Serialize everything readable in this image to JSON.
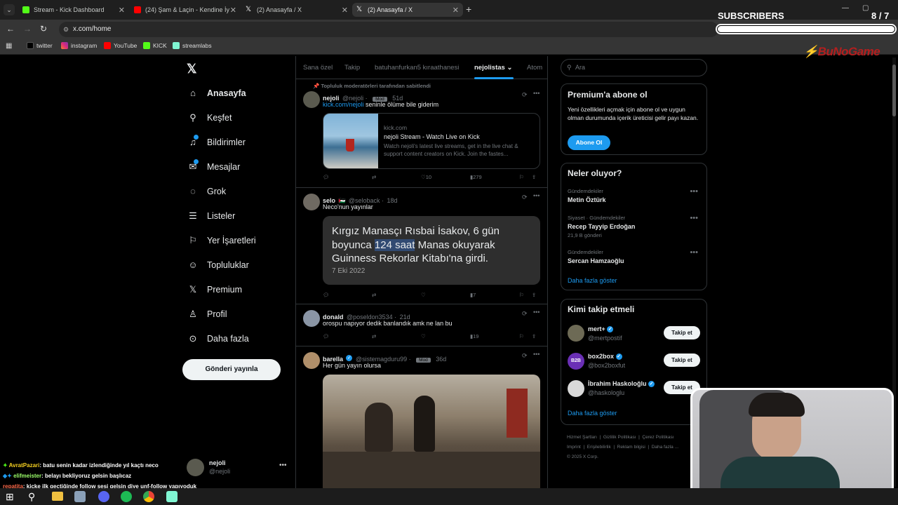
{
  "browser": {
    "tabs": [
      {
        "title": "Stream - Kick Dashboard"
      },
      {
        "title": "(24) Şam & Laçin - Kendine İyi..."
      },
      {
        "title": "(2) Anasayfa / X"
      },
      {
        "title": "(2) Anasayfa / X"
      }
    ],
    "new_tab": "+",
    "url": "x.com/home",
    "bookmarks": [
      "twitter",
      "instagram",
      "YouTube",
      "KICK",
      "streamlabs"
    ]
  },
  "overlay": {
    "subscribers_label": "SUBSCRIBERS",
    "subscribers_count": "8 / 7",
    "brand": "BuNoGame",
    "chat": [
      {
        "user": "AvratPazari",
        "text": ": batu senin kadar izlendiğinde yıl kaçtı neco"
      },
      {
        "user": "elifmeister",
        "text": ": belayı bekliyoruz gelsin başlıcaz"
      },
      {
        "user": "repatita",
        "text": ": kicke ilk geçtiğinde follow sesi gelsin diye unf-follow yapıyoduk"
      }
    ]
  },
  "sidebar": {
    "items": [
      {
        "label": "Anasayfa",
        "icon": "home-icon"
      },
      {
        "label": "Keşfet",
        "icon": "search-icon"
      },
      {
        "label": "Bildirimler",
        "icon": "bell-icon"
      },
      {
        "label": "Mesajlar",
        "icon": "mail-icon"
      },
      {
        "label": "Grok",
        "icon": "grok-icon"
      },
      {
        "label": "Listeler",
        "icon": "list-icon"
      },
      {
        "label": "Yer İşaretleri",
        "icon": "bookmark-icon"
      },
      {
        "label": "Topluluklar",
        "icon": "communities-icon"
      },
      {
        "label": "Premium",
        "icon": "x-icon"
      },
      {
        "label": "Profil",
        "icon": "person-icon"
      },
      {
        "label": "Daha fazla",
        "icon": "more-circle-icon"
      }
    ],
    "post_button": "Gönderi yayınla",
    "account": {
      "name": "nejoli",
      "handle": "@nejoli"
    }
  },
  "feed": {
    "tabs": [
      "Sana özel",
      "Takip",
      "batuhanfurkan5 kıraathanesi",
      "nejolistas",
      "Atom"
    ],
    "pinned_label": "Topluluk moderatörleri tarafından sabitlendi",
    "posts": [
      {
        "name": "nejoli",
        "handle": "@nejoli",
        "badge": "Mod",
        "time": "51d",
        "link": "kick.com/nejoli",
        "text": "seninle ölüme bile giderim",
        "card": {
          "domain": "kick.com",
          "title": "nejoli Stream - Watch Live on Kick",
          "desc": "Watch nejoli's latest live streams, get in the live chat & support content creators on Kick. Join the fastes..."
        },
        "likes": "10",
        "views": "279"
      },
      {
        "name": "selo",
        "flag": "🇵🇸",
        "handle": "@seloback",
        "time": "18d",
        "text": "Neco'nun yayınlar",
        "quote": {
          "pre": "Kırgız Manasçı Rısbai İsakov, 6 gün boyunca ",
          "highlight": "124 saat",
          "post": " Manas okuyarak Guinness Rekorlar Kitabı'na girdi.",
          "date": "7 Eki 2022"
        },
        "views": "7"
      },
      {
        "name": "donald",
        "handle": "@poseldon3534",
        "time": "21d",
        "text": "orospu napıyor dedik banlandık amk ne lan bu",
        "views": "19"
      },
      {
        "name": "barella",
        "handle": "@sistemagduru99",
        "badge": "Mod",
        "time": "36d",
        "text": "Her gün yayın olursa"
      }
    ]
  },
  "right": {
    "search_placeholder": "Ara",
    "premium": {
      "title": "Premium'a abone ol",
      "text": "Yeni özellikleri açmak için abone ol ve uygun olman durumunda içerik üreticisi gelir payı kazan.",
      "button": "Abone Ol"
    },
    "trends": {
      "title": "Neler oluyor?",
      "items": [
        {
          "context": "Gündemdekiler",
          "name": "Metin Öztürk",
          "count": ""
        },
        {
          "context": "Siyaset · Gündemdekiler",
          "name": "Recep Tayyip Erdoğan",
          "count": "21,9 B gönderi"
        },
        {
          "context": "Gündemdekiler",
          "name": "Sercan Hamzaoğlu",
          "count": ""
        }
      ],
      "more": "Daha fazla göster"
    },
    "who_to_follow": {
      "title": "Kimi takip etmeli",
      "items": [
        {
          "name": "mert+",
          "handle": "@mertpostif",
          "button": "Takip et"
        },
        {
          "name": "box2box",
          "handle": "@box2boxfut",
          "button": "Takip et",
          "avatar_text": "B2B"
        },
        {
          "name": "İbrahim Haskoloğlu",
          "handle": "@haskologlu",
          "button": "Takip et"
        }
      ],
      "more": "Daha fazla göster"
    },
    "footer": [
      "Hizmet Şartları",
      "Gizlilik Politikası",
      "Çerez Politikası",
      "Imprint",
      "Erişilebilirlik",
      "Reklam bilgisi",
      "Daha fazla ...",
      "© 2025 X Corp."
    ]
  },
  "colors": {
    "accent": "#1d9bf0",
    "kick": "#53fc18",
    "bg": "#000000"
  }
}
